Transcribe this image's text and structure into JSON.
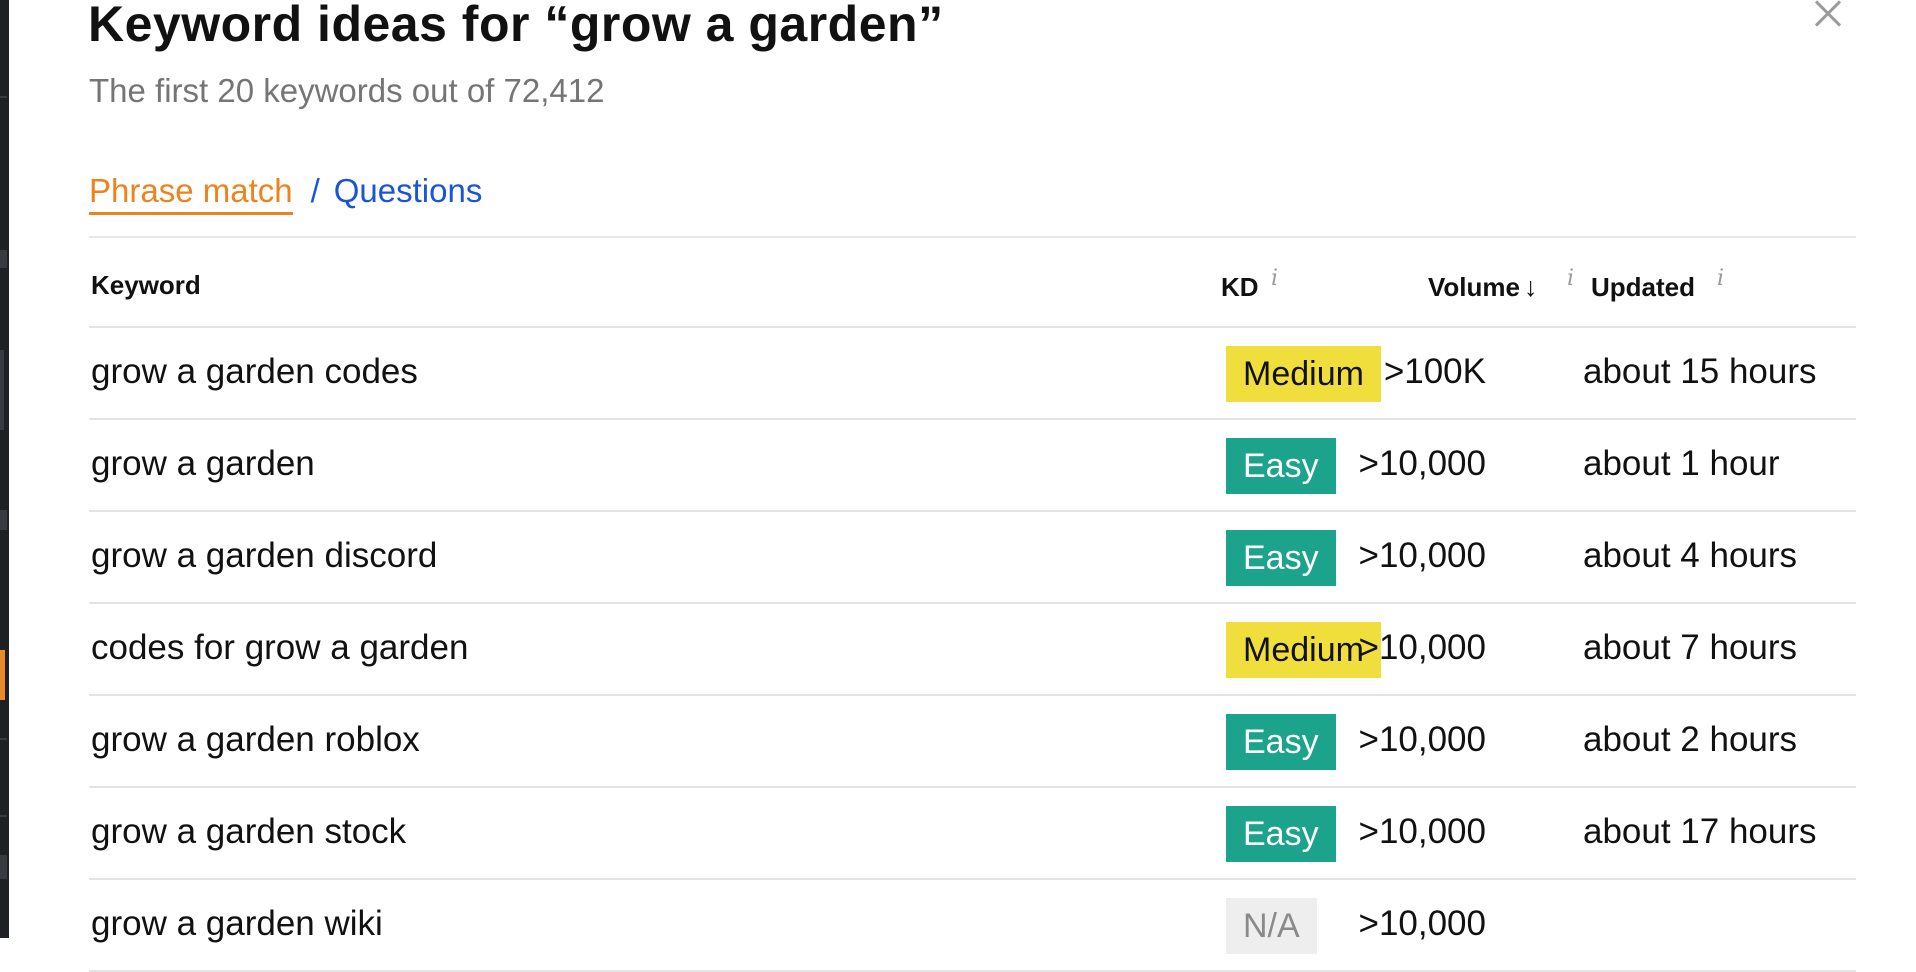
{
  "modal": {
    "title": "Keyword ideas for “grow a garden”",
    "subtitle": "The first 20 keywords out of 72,412",
    "tabs": {
      "active": "Phrase match",
      "separator": "/",
      "other": "Questions"
    },
    "columns": {
      "keyword": "Keyword",
      "kd": "KD",
      "volume": "Volume",
      "volume_sort": "↓",
      "updated": "Updated",
      "info_glyph": "i"
    },
    "rows": [
      {
        "keyword": "grow a garden codes",
        "kd": "Medium",
        "kd_level": "medium",
        "volume": ">100K",
        "updated": "about 15 hours"
      },
      {
        "keyword": "grow a garden",
        "kd": "Easy",
        "kd_level": "easy",
        "volume": ">10,000",
        "updated": "about 1 hour"
      },
      {
        "keyword": "grow a garden discord",
        "kd": "Easy",
        "kd_level": "easy",
        "volume": ">10,000",
        "updated": "about 4 hours"
      },
      {
        "keyword": "codes for grow a garden",
        "kd": "Medium",
        "kd_level": "medium",
        "volume": ">10,000",
        "updated": "about 7 hours"
      },
      {
        "keyword": "grow a garden roblox",
        "kd": "Easy",
        "kd_level": "easy",
        "volume": ">10,000",
        "updated": "about 2 hours"
      },
      {
        "keyword": "grow a garden stock",
        "kd": "Easy",
        "kd_level": "easy",
        "volume": ">10,000",
        "updated": "about 17 hours"
      },
      {
        "keyword": "grow a garden wiki",
        "kd": "N/A",
        "kd_level": "na",
        "volume": ">10,000",
        "updated": ""
      }
    ]
  },
  "colors": {
    "active_tab": "#f0821e",
    "link": "#1a55d8",
    "easy": "#1ba38b",
    "medium": "#f0de3c",
    "na": "#eeeeee"
  },
  "icons": {
    "close": "close-icon",
    "info": "info-icon",
    "sort": "sort-down-arrow-icon"
  }
}
